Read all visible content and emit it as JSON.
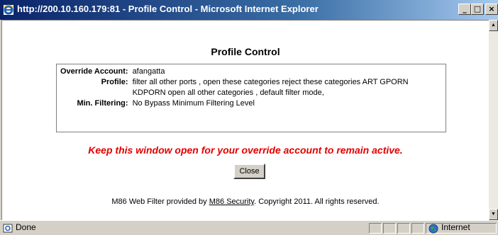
{
  "window": {
    "title": "http://200.10.160.179:81 - Profile Control - Microsoft Internet Explorer",
    "minimize_glyph": "_",
    "maximize_glyph": "□",
    "close_glyph": "×"
  },
  "page": {
    "heading": "Profile Control",
    "details": [
      {
        "label": "Override Account:",
        "value": "afangatta"
      },
      {
        "label": "Profile:",
        "value": "filter all other ports , open these categories reject these categories ART GPORN KDPORN open all other categories , default filter mode,"
      },
      {
        "label": "Min. Filtering:",
        "value": "No Bypass Minimum Filtering Level"
      }
    ],
    "warning": "Keep this window open for your override account to remain active.",
    "close_label": "Close",
    "footer": {
      "prefix": "M86 Web Filter provided by ",
      "link": "M86 Security",
      "suffix": ". Copyright 2011. All rights reserved."
    }
  },
  "statusbar": {
    "status": "Done",
    "zone": "Internet"
  },
  "colors": {
    "warning": "#e00000",
    "titlebar_start": "#0a246a",
    "titlebar_end": "#a6caf0"
  },
  "icons": {
    "title": "ie-logo-icon",
    "status": "page-done-icon",
    "zone": "globe-icon"
  }
}
